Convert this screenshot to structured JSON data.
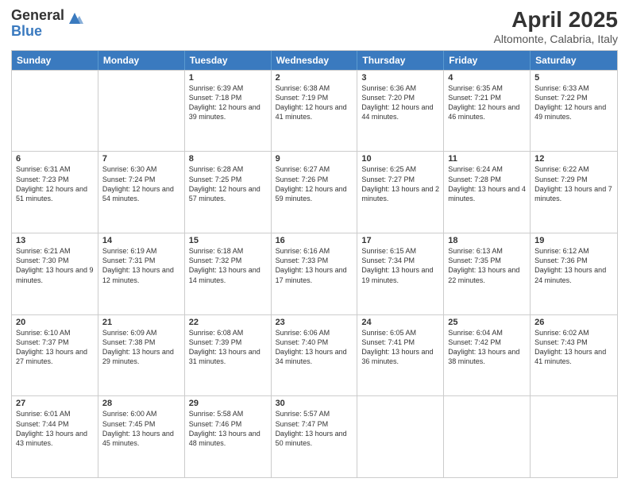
{
  "logo": {
    "general": "General",
    "blue": "Blue"
  },
  "title": "April 2025",
  "subtitle": "Altomonte, Calabria, Italy",
  "days": [
    "Sunday",
    "Monday",
    "Tuesday",
    "Wednesday",
    "Thursday",
    "Friday",
    "Saturday"
  ],
  "weeks": [
    [
      {
        "day": "",
        "info": ""
      },
      {
        "day": "",
        "info": ""
      },
      {
        "day": "1",
        "info": "Sunrise: 6:39 AM\nSunset: 7:18 PM\nDaylight: 12 hours and 39 minutes."
      },
      {
        "day": "2",
        "info": "Sunrise: 6:38 AM\nSunset: 7:19 PM\nDaylight: 12 hours and 41 minutes."
      },
      {
        "day": "3",
        "info": "Sunrise: 6:36 AM\nSunset: 7:20 PM\nDaylight: 12 hours and 44 minutes."
      },
      {
        "day": "4",
        "info": "Sunrise: 6:35 AM\nSunset: 7:21 PM\nDaylight: 12 hours and 46 minutes."
      },
      {
        "day": "5",
        "info": "Sunrise: 6:33 AM\nSunset: 7:22 PM\nDaylight: 12 hours and 49 minutes."
      }
    ],
    [
      {
        "day": "6",
        "info": "Sunrise: 6:31 AM\nSunset: 7:23 PM\nDaylight: 12 hours and 51 minutes."
      },
      {
        "day": "7",
        "info": "Sunrise: 6:30 AM\nSunset: 7:24 PM\nDaylight: 12 hours and 54 minutes."
      },
      {
        "day": "8",
        "info": "Sunrise: 6:28 AM\nSunset: 7:25 PM\nDaylight: 12 hours and 57 minutes."
      },
      {
        "day": "9",
        "info": "Sunrise: 6:27 AM\nSunset: 7:26 PM\nDaylight: 12 hours and 59 minutes."
      },
      {
        "day": "10",
        "info": "Sunrise: 6:25 AM\nSunset: 7:27 PM\nDaylight: 13 hours and 2 minutes."
      },
      {
        "day": "11",
        "info": "Sunrise: 6:24 AM\nSunset: 7:28 PM\nDaylight: 13 hours and 4 minutes."
      },
      {
        "day": "12",
        "info": "Sunrise: 6:22 AM\nSunset: 7:29 PM\nDaylight: 13 hours and 7 minutes."
      }
    ],
    [
      {
        "day": "13",
        "info": "Sunrise: 6:21 AM\nSunset: 7:30 PM\nDaylight: 13 hours and 9 minutes."
      },
      {
        "day": "14",
        "info": "Sunrise: 6:19 AM\nSunset: 7:31 PM\nDaylight: 13 hours and 12 minutes."
      },
      {
        "day": "15",
        "info": "Sunrise: 6:18 AM\nSunset: 7:32 PM\nDaylight: 13 hours and 14 minutes."
      },
      {
        "day": "16",
        "info": "Sunrise: 6:16 AM\nSunset: 7:33 PM\nDaylight: 13 hours and 17 minutes."
      },
      {
        "day": "17",
        "info": "Sunrise: 6:15 AM\nSunset: 7:34 PM\nDaylight: 13 hours and 19 minutes."
      },
      {
        "day": "18",
        "info": "Sunrise: 6:13 AM\nSunset: 7:35 PM\nDaylight: 13 hours and 22 minutes."
      },
      {
        "day": "19",
        "info": "Sunrise: 6:12 AM\nSunset: 7:36 PM\nDaylight: 13 hours and 24 minutes."
      }
    ],
    [
      {
        "day": "20",
        "info": "Sunrise: 6:10 AM\nSunset: 7:37 PM\nDaylight: 13 hours and 27 minutes."
      },
      {
        "day": "21",
        "info": "Sunrise: 6:09 AM\nSunset: 7:38 PM\nDaylight: 13 hours and 29 minutes."
      },
      {
        "day": "22",
        "info": "Sunrise: 6:08 AM\nSunset: 7:39 PM\nDaylight: 13 hours and 31 minutes."
      },
      {
        "day": "23",
        "info": "Sunrise: 6:06 AM\nSunset: 7:40 PM\nDaylight: 13 hours and 34 minutes."
      },
      {
        "day": "24",
        "info": "Sunrise: 6:05 AM\nSunset: 7:41 PM\nDaylight: 13 hours and 36 minutes."
      },
      {
        "day": "25",
        "info": "Sunrise: 6:04 AM\nSunset: 7:42 PM\nDaylight: 13 hours and 38 minutes."
      },
      {
        "day": "26",
        "info": "Sunrise: 6:02 AM\nSunset: 7:43 PM\nDaylight: 13 hours and 41 minutes."
      }
    ],
    [
      {
        "day": "27",
        "info": "Sunrise: 6:01 AM\nSunset: 7:44 PM\nDaylight: 13 hours and 43 minutes."
      },
      {
        "day": "28",
        "info": "Sunrise: 6:00 AM\nSunset: 7:45 PM\nDaylight: 13 hours and 45 minutes."
      },
      {
        "day": "29",
        "info": "Sunrise: 5:58 AM\nSunset: 7:46 PM\nDaylight: 13 hours and 48 minutes."
      },
      {
        "day": "30",
        "info": "Sunrise: 5:57 AM\nSunset: 7:47 PM\nDaylight: 13 hours and 50 minutes."
      },
      {
        "day": "",
        "info": ""
      },
      {
        "day": "",
        "info": ""
      },
      {
        "day": "",
        "info": ""
      }
    ]
  ]
}
